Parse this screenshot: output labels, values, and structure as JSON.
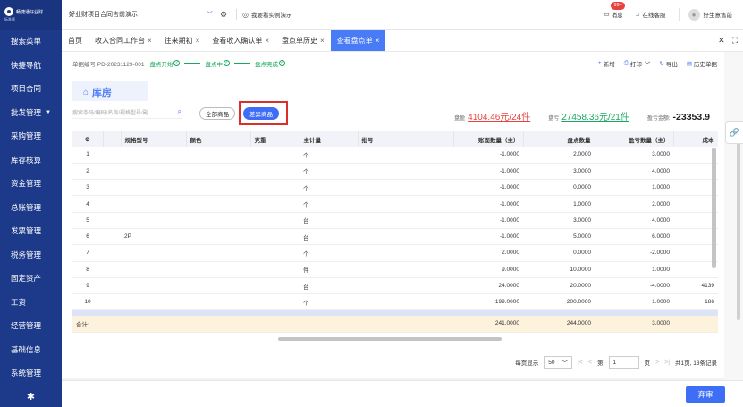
{
  "app": {
    "logo_text": "畅捷通好业财",
    "logo_sub": "标准版"
  },
  "topbar": {
    "company": "好业财项目合同售前演示",
    "want_example": "我要看实例演示",
    "messages_label": "消息",
    "messages_badge": "99+",
    "service_label": "在线客服",
    "user_name": "好生意售前"
  },
  "sidebar": {
    "items": [
      {
        "label": "搜索菜单"
      },
      {
        "label": "快捷导航"
      },
      {
        "label": "项目合同"
      },
      {
        "label": "批发管理",
        "caret": "▼"
      },
      {
        "label": "采购管理"
      },
      {
        "label": "库存核算"
      },
      {
        "label": "资金管理"
      },
      {
        "label": "总账管理"
      },
      {
        "label": "发票管理"
      },
      {
        "label": "税务管理"
      },
      {
        "label": "固定资产"
      },
      {
        "label": "工资"
      },
      {
        "label": "经营管理"
      },
      {
        "label": "基础信息"
      },
      {
        "label": "系统管理"
      }
    ]
  },
  "tabs": [
    {
      "label": "首页",
      "closable": false
    },
    {
      "label": "收入合同工作台",
      "closable": true
    },
    {
      "label": "往来期初",
      "closable": true
    },
    {
      "label": "查看收入确认单",
      "closable": true
    },
    {
      "label": "盘点单历史",
      "closable": true
    },
    {
      "label": "查看盘点单",
      "closable": true,
      "active": true
    }
  ],
  "tab_close_glyph": "×",
  "docbar": {
    "doc_no": "单据编号 PD-20231129-001",
    "steps": [
      "盘点开始",
      "盘点中",
      "盘点完成"
    ],
    "actions": [
      "新增",
      "打印",
      "导出",
      "历史单据"
    ]
  },
  "warehouse": {
    "title": "库房"
  },
  "search": {
    "placeholder": "搜索条码/编码/名称/规格型号/副"
  },
  "filters": {
    "all": "全部商品",
    "diff": "差异商品"
  },
  "summary": {
    "surplus_label": "盘盈",
    "surplus_value": "4104.46元/24件",
    "loss_label": "盘亏",
    "loss_value": "27458.36元/21件",
    "pl_label": "盈亏金额:",
    "pl_value": "-23353.9"
  },
  "table": {
    "headers": [
      "规格型号",
      "颜色",
      "克重",
      "主计量",
      "批号",
      "账面数量（主）",
      "盘点数量",
      "盈亏数量（主）",
      "成本"
    ],
    "rows": [
      {
        "n": "1",
        "spec": "",
        "unit": "个",
        "book": "-1.0000",
        "count": "2.0000",
        "diff": "3.0000",
        "cost": ""
      },
      {
        "n": "2",
        "spec": "",
        "unit": "个",
        "book": "-1.0000",
        "count": "3.0000",
        "diff": "4.0000",
        "cost": ""
      },
      {
        "n": "3",
        "spec": "",
        "unit": "个",
        "book": "-1.0000",
        "count": "0.0000",
        "diff": "1.0000",
        "cost": ""
      },
      {
        "n": "4",
        "spec": "",
        "unit": "个",
        "book": "-1.0000",
        "count": "1.0000",
        "diff": "2.0000",
        "cost": ""
      },
      {
        "n": "5",
        "spec": "",
        "unit": "台",
        "book": "-1.0000",
        "count": "3.0000",
        "diff": "4.0000",
        "cost": ""
      },
      {
        "n": "6",
        "spec": "2P",
        "unit": "台",
        "book": "-1.0000",
        "count": "5.0000",
        "diff": "6.0000",
        "cost": ""
      },
      {
        "n": "7",
        "spec": "",
        "unit": "个",
        "book": "2.0000",
        "count": "0.0000",
        "diff": "-2.0000",
        "cost": ""
      },
      {
        "n": "8",
        "spec": "",
        "unit": "件",
        "book": "9.0000",
        "count": "10.0000",
        "diff": "1.0000",
        "cost": ""
      },
      {
        "n": "9",
        "spec": "",
        "unit": "台",
        "book": "24.0000",
        "count": "20.0000",
        "diff": "-4.0000",
        "cost": "4139"
      },
      {
        "n": "10",
        "spec": "",
        "unit": "个",
        "book": "199.0000",
        "count": "200.0000",
        "diff": "1.0000",
        "cost": "186"
      }
    ],
    "total": {
      "label": "合计:",
      "book": "241.0000",
      "count": "244.0000",
      "diff": "3.0000"
    }
  },
  "pager": {
    "per_page_label": "每页显示",
    "per_page": "50",
    "page_prefix": "第",
    "page": "1",
    "page_suffix": "页",
    "info": "共1页, 13条记录"
  },
  "footer": {
    "review": "弃审"
  }
}
